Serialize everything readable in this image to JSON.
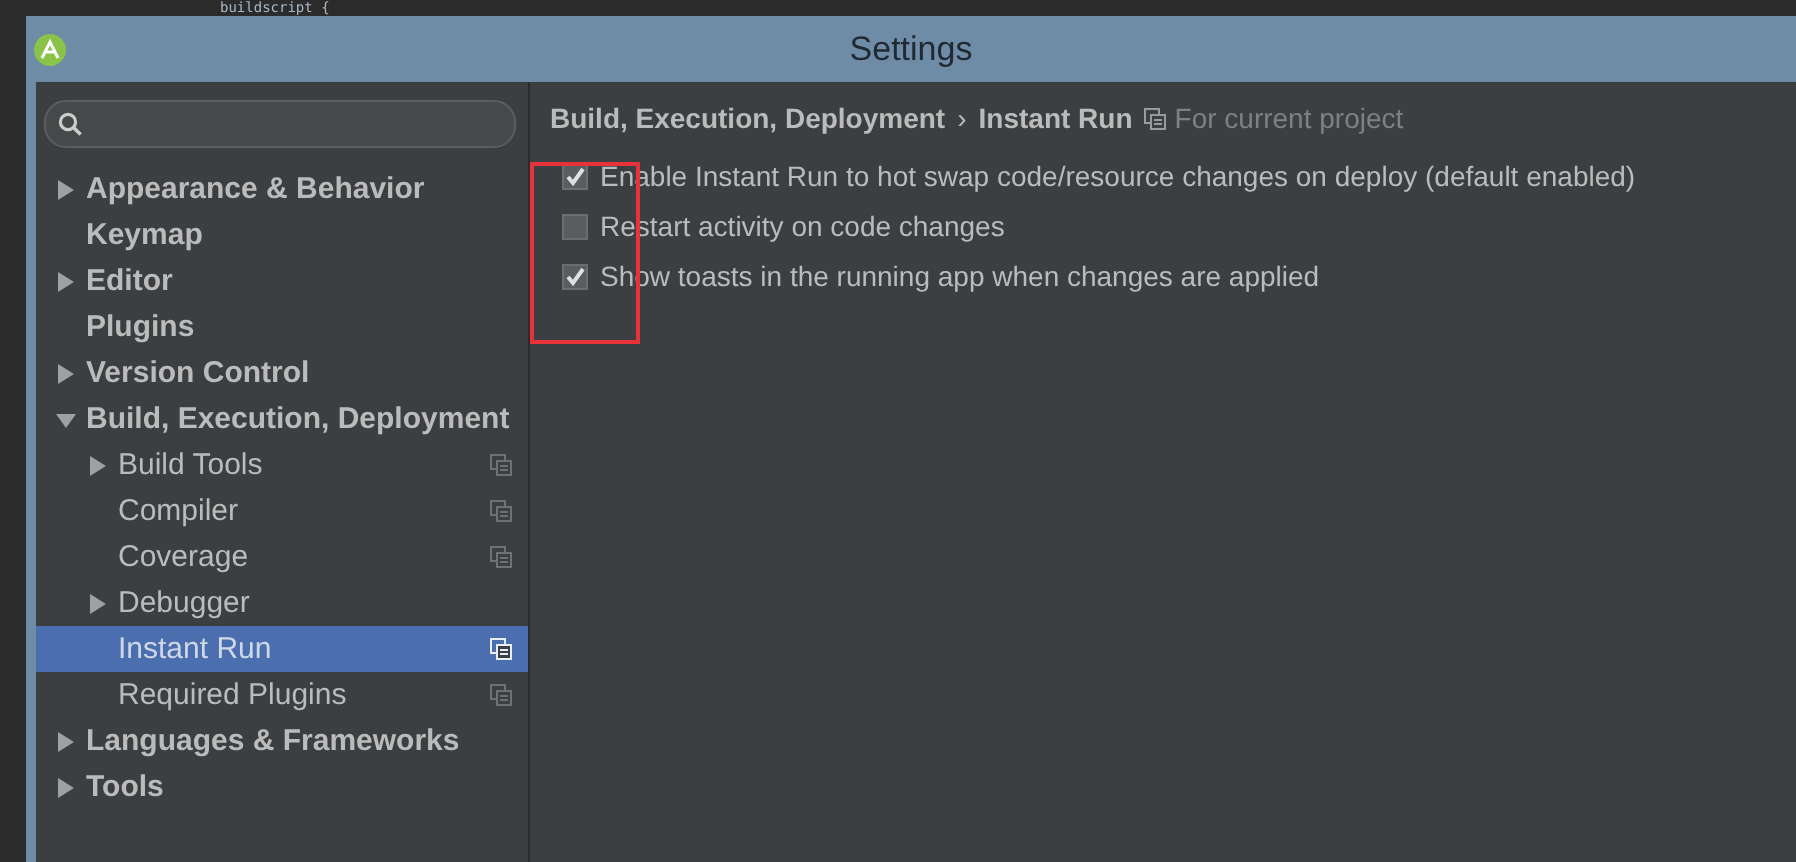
{
  "editor": {
    "code_line": "buildscript {"
  },
  "window": {
    "title": "Settings"
  },
  "sidebar": {
    "items": [
      {
        "label": "Appearance & Behavior",
        "kind": "folder",
        "expanded": false,
        "selected": false,
        "project_scope": false
      },
      {
        "label": "Keymap",
        "kind": "page",
        "selected": false,
        "project_scope": false
      },
      {
        "label": "Editor",
        "kind": "folder",
        "expanded": false,
        "selected": false,
        "project_scope": false
      },
      {
        "label": "Plugins",
        "kind": "page",
        "selected": false,
        "project_scope": false
      },
      {
        "label": "Version Control",
        "kind": "folder",
        "expanded": false,
        "selected": false,
        "project_scope": false
      },
      {
        "label": "Build, Execution, Deployment",
        "kind": "folder",
        "expanded": true,
        "selected": false,
        "project_scope": false,
        "children": [
          {
            "label": "Build Tools",
            "kind": "folder",
            "expanded": false,
            "selected": false,
            "project_scope": true
          },
          {
            "label": "Compiler",
            "kind": "page",
            "selected": false,
            "project_scope": true
          },
          {
            "label": "Coverage",
            "kind": "page",
            "selected": false,
            "project_scope": true
          },
          {
            "label": "Debugger",
            "kind": "folder",
            "expanded": false,
            "selected": false,
            "project_scope": false
          },
          {
            "label": "Instant Run",
            "kind": "page",
            "selected": true,
            "project_scope": true
          },
          {
            "label": "Required Plugins",
            "kind": "page",
            "selected": false,
            "project_scope": true
          }
        ]
      },
      {
        "label": "Languages & Frameworks",
        "kind": "folder",
        "expanded": false,
        "selected": false,
        "project_scope": false
      },
      {
        "label": "Tools",
        "kind": "folder",
        "expanded": false,
        "selected": false,
        "project_scope": false
      }
    ]
  },
  "breadcrumb": [
    "Build, Execution, Deployment",
    "Instant Run"
  ],
  "breadcrumb_separator": "›",
  "scope_note": "For current project",
  "options": [
    {
      "label": "Enable Instant Run to hot swap code/resource changes on deploy (default enabled)",
      "checked": true
    },
    {
      "label": "Restart activity on code changes",
      "checked": false
    },
    {
      "label": "Show toasts in the running app when changes are applied",
      "checked": true
    }
  ]
}
